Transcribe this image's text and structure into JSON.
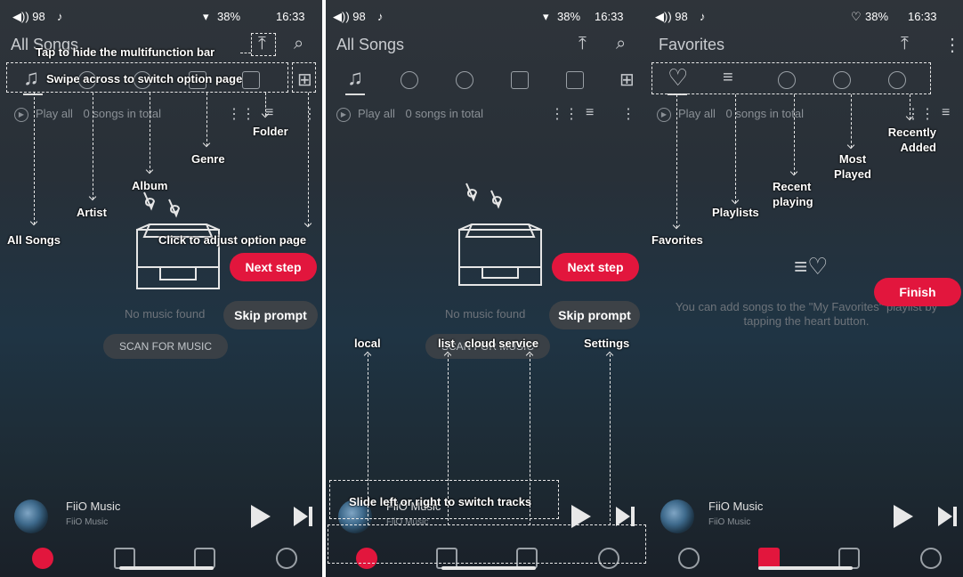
{
  "status": {
    "volume": "◀)) 98",
    "battery": "38%",
    "time": "16:33"
  },
  "panel1": {
    "title": "All Songs",
    "play_all": "Play all",
    "songs_count": "0 songs in total",
    "empty_text": "No music found",
    "scan_button": "SCAN FOR MUSIC",
    "next_step": "Next step",
    "skip_prompt": "Skip prompt",
    "track": "FiiO Music",
    "artist": "FiiO Music",
    "annotations": {
      "hide_bar": "Tap to hide the multifunction bar",
      "swipe": "Swipe across to switch option page",
      "folder": "Folder",
      "genre": "Genre",
      "album": "Album",
      "artist": "Artist",
      "all_songs": "All Songs",
      "adjust": "Click to adjust option page"
    }
  },
  "panel2": {
    "title": "All Songs",
    "play_all": "Play all",
    "songs_count": "0 songs in total",
    "empty_text": "No music found",
    "scan_button": "SCAN FOR MUSIC",
    "next_step": "Next step",
    "skip_prompt": "Skip prompt",
    "track": "FiiO Music",
    "artist": "FiiO Music",
    "annotations": {
      "local": "local",
      "list": "list",
      "cloud": "cloud service",
      "settings": "Settings",
      "slide": "Slide left or right to switch tracks"
    }
  },
  "panel3": {
    "title": "Favorites",
    "play_all": "Play all",
    "songs_count": "0 songs in total",
    "empty_text": "You can add songs to the \"My Favorites\" playlist by tapping the heart button.",
    "finish": "Finish",
    "track": "FiiO Music",
    "artist": "FiiO Music",
    "annotations": {
      "favorites": "Favorites",
      "playlists": "Playlists",
      "recent_playing": "Recent playing",
      "most_played": "Most Played",
      "recently_added": "Recently Added"
    }
  },
  "colors": {
    "accent": "#e2163d",
    "bg": "#283038"
  }
}
